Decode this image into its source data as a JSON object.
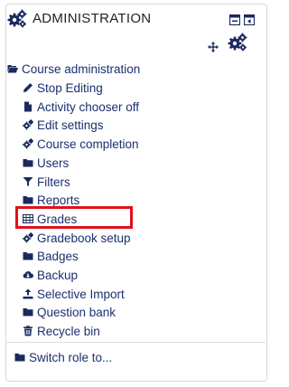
{
  "block": {
    "title": "ADMINISTRATION"
  },
  "tree": {
    "root": {
      "label": "Course administration",
      "icon": "folder-open-icon"
    },
    "items": [
      {
        "label": "Stop Editing",
        "icon": "pencil-icon"
      },
      {
        "label": "Activity chooser off",
        "icon": "file-icon"
      },
      {
        "label": "Edit settings",
        "icon": "gear-icon"
      },
      {
        "label": "Course completion",
        "icon": "gear-icon"
      },
      {
        "label": "Users",
        "icon": "folder-icon"
      },
      {
        "label": "Filters",
        "icon": "filter-icon"
      },
      {
        "label": "Reports",
        "icon": "folder-icon"
      },
      {
        "label": "Grades",
        "icon": "table-icon"
      },
      {
        "label": "Gradebook setup",
        "icon": "gear-icon"
      },
      {
        "label": "Badges",
        "icon": "folder-icon"
      },
      {
        "label": "Backup",
        "icon": "cloud-download-icon"
      },
      {
        "label": "Selective Import",
        "icon": "upload-icon"
      },
      {
        "label": "Question bank",
        "icon": "folder-icon"
      },
      {
        "label": "Recycle bin",
        "icon": "trash-icon"
      }
    ],
    "switch_role": {
      "label": "Switch role to...",
      "icon": "folder-icon"
    }
  },
  "colors": {
    "link": "#1a3070",
    "icon": "#1a2a5c",
    "highlight": "#e0101a"
  }
}
